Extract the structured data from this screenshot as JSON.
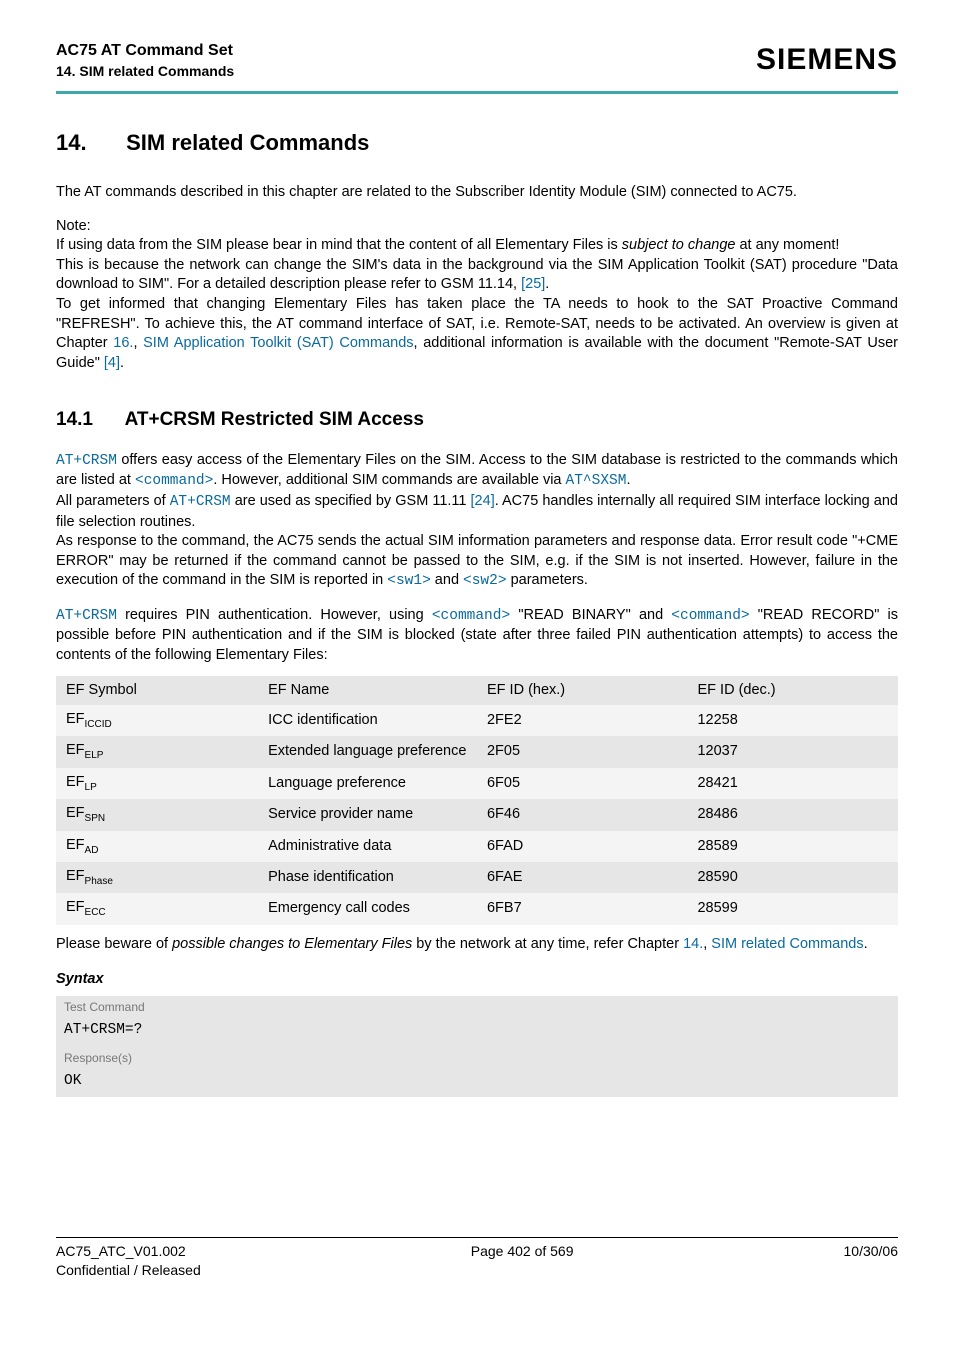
{
  "header": {
    "doc_title": "AC75 AT Command Set",
    "section_label": "14. SIM related Commands",
    "brand": "SIEMENS"
  },
  "chapter": {
    "number": "14.",
    "title": "SIM related Commands"
  },
  "intro": {
    "p1": "The AT commands described in this chapter are related to the Subscriber Identity Module (SIM) connected to AC75.",
    "note_label": " Note:",
    "p2a": "If using data from the SIM please bear in mind that the content of all Elementary Files is ",
    "p2b_italic": "subject to change",
    "p2c": " at any moment!",
    "p3a": "This is because the network can change the SIM's data in the background via the SIM Application Toolkit (SAT) procedure \"Data download to SIM\". For a detailed description please refer to GSM 11.14, ",
    "p3_ref": "[25]",
    "p3b": ".",
    "p4a": "To get informed that changing Elementary Files has taken place the TA needs to hook to the SAT Proactive Command \"REFRESH\". To achieve this, the AT command interface of SAT, i.e. Remote-SAT, needs to be activated. An overview is given at Chapter ",
    "p4_link1": "16.",
    "p4b": ", ",
    "p4_link2": "SIM Application Toolkit (SAT) Commands",
    "p4c": ", additional information is available with the document \"Remote-SAT User Guide\" ",
    "p4_ref": "[4]",
    "p4d": "."
  },
  "section": {
    "number": "14.1",
    "title": "AT+CRSM   Restricted SIM Access"
  },
  "body": {
    "p1a_mono": "AT+CRSM",
    "p1b": " offers easy access of the Elementary Files on the SIM. Access to the SIM database is restricted to the commands which are listed at ",
    "p1c_mono": "<command>",
    "p1d": ". However, additional SIM commands are available via ",
    "p1e_mono": "AT^SXSM",
    "p1f": ".",
    "p2a": "All parameters of ",
    "p2b_mono": "AT+CRSM",
    "p2c": " are used as specified by GSM 11.11 ",
    "p2_ref": "[24]",
    "p2d": ". AC75 handles internally all required SIM interface locking and file selection routines.",
    "p3a": "As response to the command, the AC75 sends the actual SIM information parameters and response data. Error result code \"+CME ERROR\" may be returned if the command cannot be passed to the SIM, e.g. if the SIM is not inserted. However, failure in the execution of the command in the SIM is reported in ",
    "p3b_mono": "<sw1>",
    "p3c": " and ",
    "p3d_mono": "<sw2>",
    "p3e": " parameters.",
    "p4a_mono": "AT+CRSM",
    "p4b": " requires PIN authentication. However, using ",
    "p4c_mono": "<command>",
    "p4d": " \"READ BINARY\" and ",
    "p4e_mono": "<command>",
    "p4f": " \"READ RECORD\" is possible before PIN authentication and if the SIM is blocked (state after three failed PIN authentication attempts) to access the contents of the following Elementary Files:",
    "beware_a": "Please beware of ",
    "beware_b_italic": "possible changes to Elementary Files",
    "beware_c": " by the network at any time, refer Chapter ",
    "beware_link1": "14.",
    "beware_d": ", ",
    "beware_link2": "SIM related Commands",
    "beware_e": "."
  },
  "table": {
    "headers": {
      "c1": "EF Symbol",
      "c2": "EF Name",
      "c3": "EF ID (hex.)",
      "c4": "EF ID (dec.)"
    },
    "rows": [
      {
        "sym_pre": "EF",
        "sym_sub": "ICCID",
        "name": "ICC identification",
        "hex": "2FE2",
        "dec": "12258"
      },
      {
        "sym_pre": "EF",
        "sym_sub": "ELP",
        "name": "Extended language preference",
        "hex": "2F05",
        "dec": "12037"
      },
      {
        "sym_pre": "EF",
        "sym_sub": "LP",
        "name": "Language preference",
        "hex": "6F05",
        "dec": "28421"
      },
      {
        "sym_pre": "EF",
        "sym_sub": "SPN",
        "name": "Service provider name",
        "hex": "6F46",
        "dec": "28486"
      },
      {
        "sym_pre": "EF",
        "sym_sub": "AD",
        "name": "Administrative data",
        "hex": "6FAD",
        "dec": "28589"
      },
      {
        "sym_pre": "EF",
        "sym_sub": "Phase",
        "name": "Phase identification",
        "hex": "6FAE",
        "dec": "28590"
      },
      {
        "sym_pre": "EF",
        "sym_sub": "ECC",
        "name": "Emergency call codes",
        "hex": "6FB7",
        "dec": "28599"
      }
    ]
  },
  "syntax": {
    "label": "Syntax",
    "test_label": "Test Command",
    "test_value": "AT+CRSM=?",
    "resp_label": "Response(s)",
    "resp_value": "OK"
  },
  "footer": {
    "left1": "AC75_ATC_V01.002",
    "left2": "Confidential / Released",
    "center": "Page 402 of 569",
    "right": "10/30/06"
  },
  "colors": {
    "row_odd": "#e6e6e6",
    "row_even": "#f4f4f4"
  }
}
